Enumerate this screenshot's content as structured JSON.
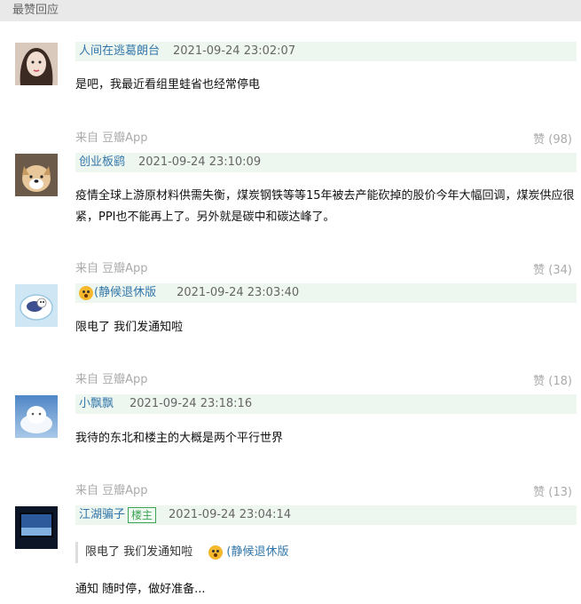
{
  "header": {
    "title": "最赞回应"
  },
  "comments": [
    {
      "author": "人间在逃葛朗台",
      "time": "2021-09-24 23:02:07",
      "content": "是吧，我最近看组里蛙省也经常停电",
      "source": "来自 豆瓣App",
      "likes": "赞 (98)"
    },
    {
      "author": "创业板鹞",
      "time": "2021-09-24 23:10:09",
      "content": "疫情全球上游原材料供需失衡，煤炭钢铁等等15年被去产能砍掉的股价今年大幅回调，煤炭供应很紧，PPI也不能再上了。另外就是碳中和碳达峰了。",
      "source": "来自 豆瓣App",
      "likes": "赞 (34)"
    },
    {
      "author": "(静候退休版",
      "time": "2021-09-24 23:03:40",
      "content": "限电了 我们发通知啦",
      "source": "来自 豆瓣App",
      "likes": "赞 (18)"
    },
    {
      "author": "小飘飘",
      "time": "2021-09-24 23:18:16",
      "content": "我待的东北和楼主的大概是两个平行世界",
      "source": "来自 豆瓣App",
      "likes": "赞 (13)"
    },
    {
      "author": "江湖骗子",
      "badge": "楼主",
      "time": "2021-09-24 23:04:14",
      "quote_text": "限电了 我们发通知啦",
      "quote_author": "(静候退休版",
      "content": "通知 随时停，做好准备..."
    }
  ],
  "colors": {
    "link": "#3377aa",
    "meta_bg": "#eef6f0",
    "muted": "#aaaaaa",
    "op_badge": "#3ca353"
  },
  "icons": {
    "reply_avatar": "emoji-face-icon"
  }
}
